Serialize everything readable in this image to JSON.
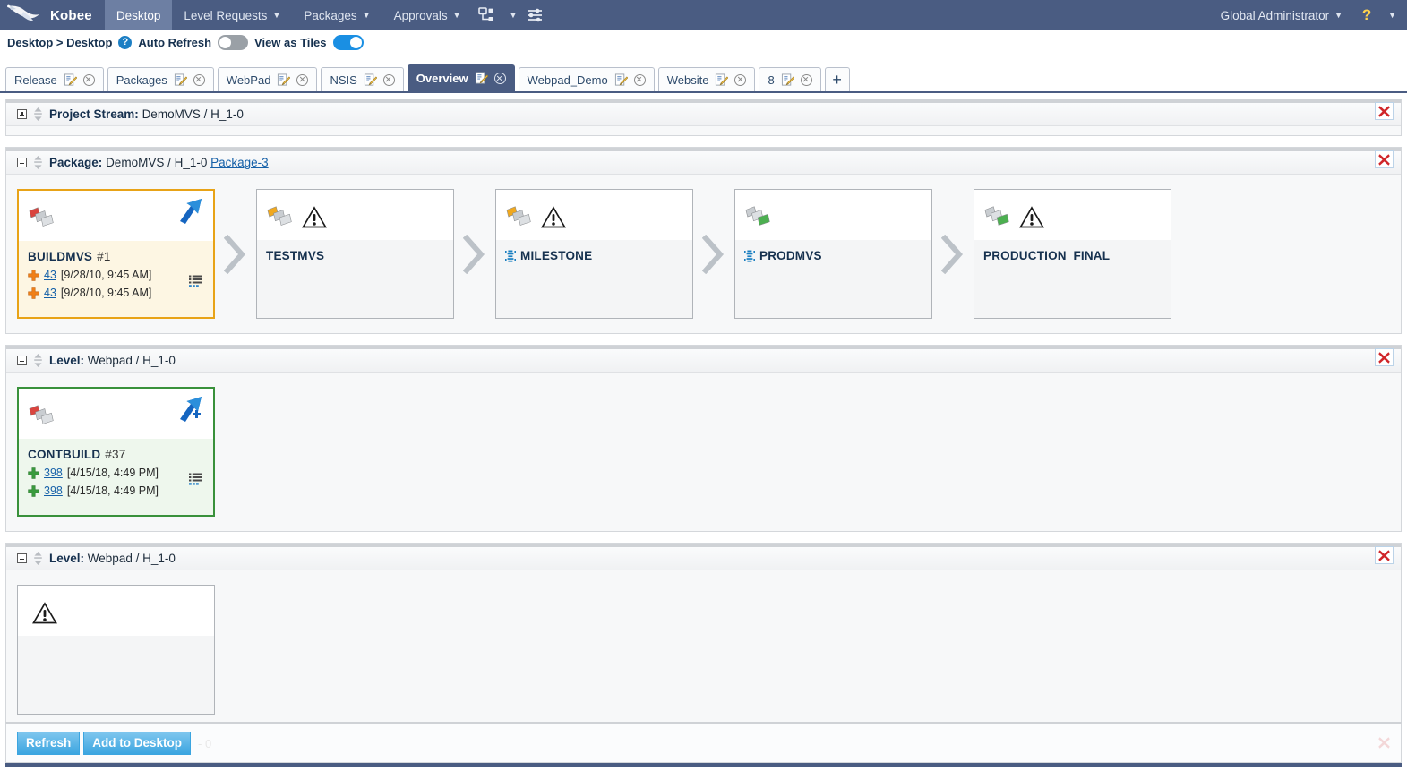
{
  "colors": {
    "nav_bg": "#4a5c82",
    "nav_active": "#6d7fa3",
    "accent_blue": "#1a8fe3",
    "link_blue": "#1560a8",
    "warn_orange": "#e8a317",
    "ok_green": "#39913b",
    "danger_red": "#d0262a"
  },
  "topnav": {
    "logo_icon": "hummingbird-logo-icon",
    "brand": "Kobee",
    "items": [
      {
        "label": "Desktop",
        "caret": false,
        "active": true
      },
      {
        "label": "Level Requests",
        "caret": true,
        "active": false
      },
      {
        "label": "Packages",
        "caret": true,
        "active": false
      },
      {
        "label": "Approvals",
        "caret": true,
        "active": false
      }
    ],
    "icons": [
      {
        "name": "sitemap-icon",
        "caret": true
      },
      {
        "name": "sliders-settings-icon",
        "caret": false
      }
    ],
    "user": {
      "label": "Global Administrator",
      "caret": true
    },
    "help": {
      "label": "?",
      "caret": true
    }
  },
  "crumbbar": {
    "breadcrumb": "Desktop > Desktop",
    "help_icon_label": "?",
    "auto_refresh": {
      "label": "Auto Refresh",
      "state": "off"
    },
    "view_as_tiles": {
      "label": "View as Tiles",
      "state": "on"
    }
  },
  "tabs": {
    "items": [
      {
        "label": "Release",
        "active": false
      },
      {
        "label": "Packages",
        "active": false
      },
      {
        "label": "WebPad",
        "active": false
      },
      {
        "label": "NSIS",
        "active": false
      },
      {
        "label": "Overview",
        "active": true
      },
      {
        "label": "Webpad_Demo",
        "active": false
      },
      {
        "label": "Website",
        "active": false
      },
      {
        "label": "8",
        "active": false
      }
    ],
    "add_label": "+",
    "note_icon": "note-pencil-icon",
    "close_icon": "close-circle-icon"
  },
  "panels": [
    {
      "id": "project-stream",
      "expander": "plus",
      "collapsed": true,
      "title_prefix": "Project Stream:",
      "title_value": "DemoMVS / H_1-0",
      "link": null,
      "close_icon": "remove-panel-icon",
      "tiles": []
    },
    {
      "id": "package",
      "expander": "minus",
      "collapsed": false,
      "title_prefix": "Package:",
      "title_value": "DemoMVS / H_1-0",
      "link": "Package-3",
      "close_icon": "remove-panel-icon",
      "tiles": [
        {
          "name": "BUILDMVS",
          "number": "#1",
          "stack_icon": "layers-red-icon",
          "warn_icon": null,
          "rise_icon": "blue-rising-arrow-icon",
          "milestone_icon": null,
          "highlight": "orange",
          "list_icon": "list-details-icon",
          "lines": [
            {
              "plus_color": "orange",
              "count": "43",
              "timestamp": "[9/28/10, 9:45 AM]"
            },
            {
              "plus_color": "orange",
              "count": "43",
              "timestamp": "[9/28/10, 9:45 AM]"
            }
          ]
        },
        {
          "name": "TESTMVS",
          "number": "",
          "stack_icon": "layers-orange-icon",
          "warn_icon": "warning-triangle-icon",
          "rise_icon": null,
          "milestone_icon": null,
          "highlight": "none",
          "list_icon": null,
          "lines": []
        },
        {
          "name": "MILESTONE",
          "number": "",
          "stack_icon": "layers-orange-icon",
          "warn_icon": "warning-triangle-icon",
          "rise_icon": null,
          "milestone_icon": "milestone-marker-icon",
          "highlight": "none",
          "list_icon": null,
          "lines": []
        },
        {
          "name": "PRODMVS",
          "number": "",
          "stack_icon": "layers-green-icon",
          "warn_icon": null,
          "rise_icon": null,
          "milestone_icon": "milestone-marker-icon",
          "highlight": "none",
          "list_icon": null,
          "lines": []
        },
        {
          "name": "PRODUCTION_FINAL",
          "number": "",
          "stack_icon": "layers-green-icon",
          "warn_icon": "warning-triangle-icon",
          "rise_icon": null,
          "milestone_icon": null,
          "highlight": "none",
          "list_icon": null,
          "lines": []
        }
      ]
    },
    {
      "id": "level-webpad-1",
      "expander": "minus",
      "collapsed": false,
      "title_prefix": "Level:",
      "title_value": "Webpad / H_1-0",
      "link": null,
      "close_icon": "remove-panel-icon",
      "tiles": [
        {
          "name": "CONTBUILD",
          "number": "#37",
          "stack_icon": "layers-red-icon",
          "warn_icon": null,
          "rise_icon": "blue-rising-arrow-plus-icon",
          "milestone_icon": null,
          "highlight": "green",
          "list_icon": "list-details-icon",
          "lines": [
            {
              "plus_color": "green",
              "count": "398",
              "timestamp": "[4/15/18, 4:49 PM]"
            },
            {
              "plus_color": "green",
              "count": "398",
              "timestamp": "[4/15/18, 4:49 PM]"
            }
          ]
        }
      ]
    },
    {
      "id": "level-webpad-2",
      "expander": "minus",
      "collapsed": false,
      "title_prefix": "Level:",
      "title_value": "Webpad / H_1-0",
      "link": null,
      "close_icon": "remove-panel-icon",
      "tiles": [
        {
          "name": "",
          "number": "",
          "stack_icon": null,
          "warn_icon": "warning-triangle-icon",
          "rise_icon": null,
          "milestone_icon": null,
          "highlight": "none",
          "list_icon": null,
          "lines": []
        }
      ]
    }
  ],
  "footer": {
    "refresh_label": "Refresh",
    "add_to_desktop_label": "Add to Desktop",
    "ghost_text": "- 0",
    "close_icon": "remove-panel-icon"
  }
}
